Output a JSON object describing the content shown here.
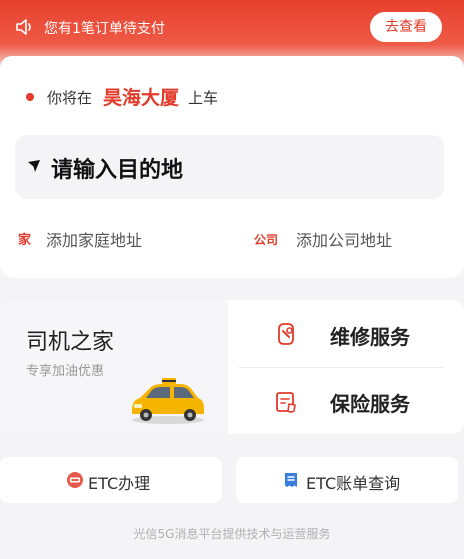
{
  "banner": {
    "notice_icon": "speaker-icon",
    "text": "您有1笔订单待支付",
    "button": "去查看"
  },
  "pickup": {
    "prefix": "你将在",
    "place": "昊海大厦",
    "suffix": "上车"
  },
  "destination": {
    "icon": "location-arrow-icon",
    "placeholder": "请输入目的地"
  },
  "shortcuts": {
    "home_tag": "家",
    "home_label": "添加家庭地址",
    "company_tag": "公司",
    "company_label": "添加公司地址"
  },
  "driver_home": {
    "title": "司机之家",
    "subtitle": "专享加油优惠",
    "image": "taxi-icon"
  },
  "services": [
    {
      "label": "维修服务",
      "icon": "wrench-icon"
    },
    {
      "label": "保险服务",
      "icon": "insurance-icon"
    }
  ],
  "bottom_buttons": [
    {
      "label": "ETC办理",
      "icon": "etc-icon"
    },
    {
      "label": "ETC账单查询",
      "icon": "bill-icon"
    }
  ],
  "footer": "光信5G消息平台提供技术与运营服务",
  "colors": {
    "accent": "#e23b2b",
    "banner_gradient_top": "#e8402f"
  }
}
